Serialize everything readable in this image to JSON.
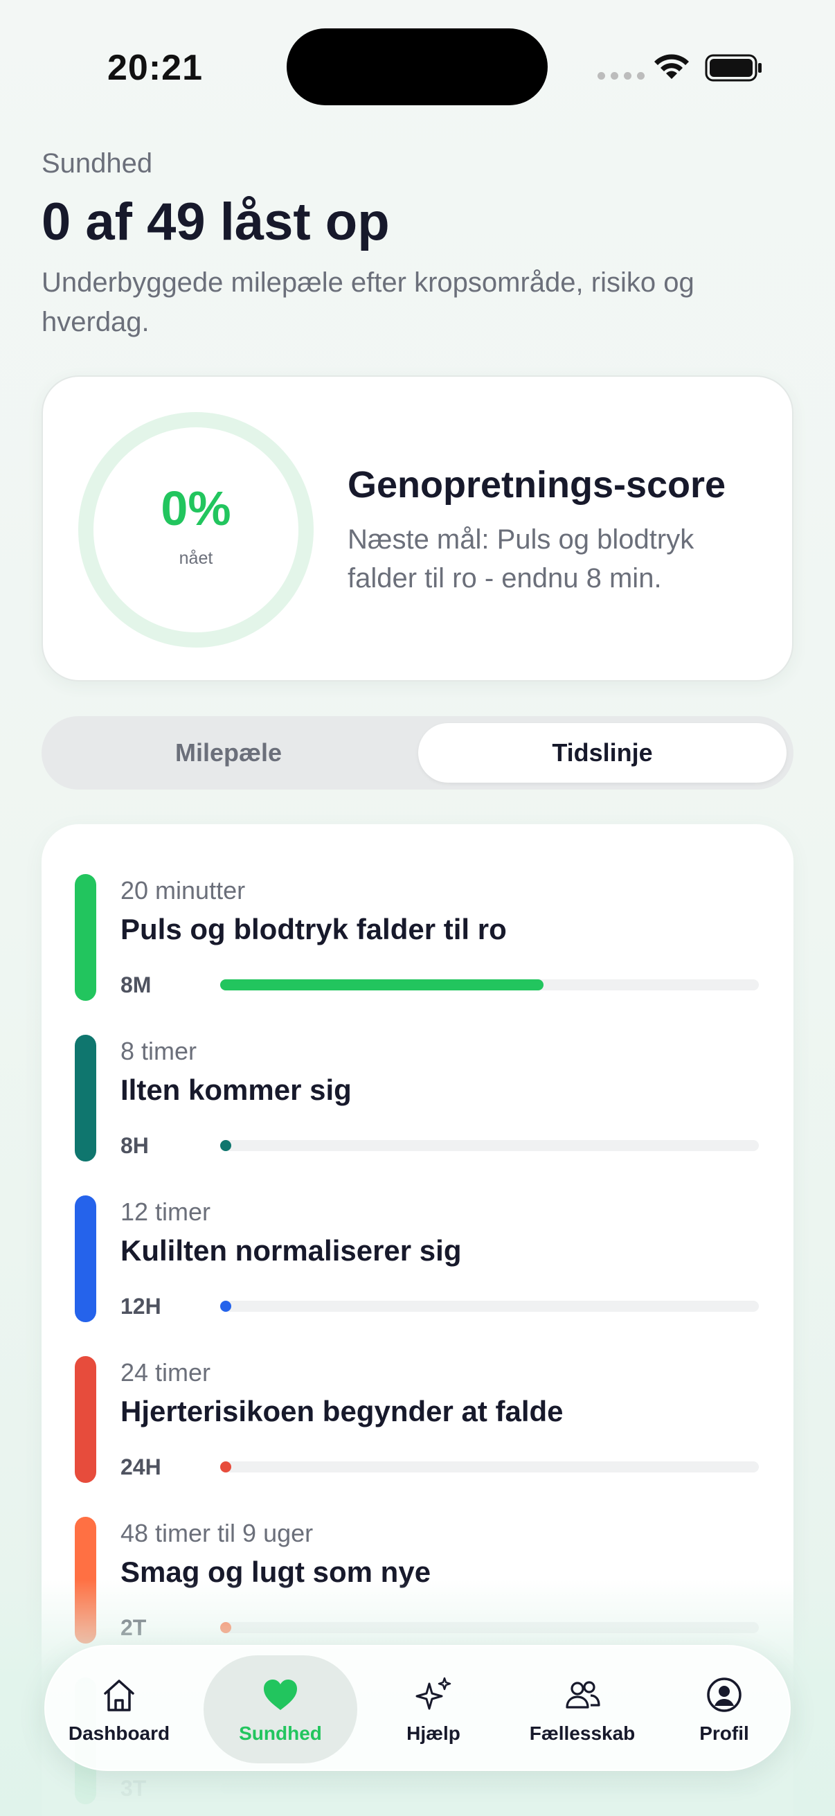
{
  "status_bar": {
    "time": "20:21"
  },
  "header": {
    "section": "Sundhed",
    "title": "0 af 49 låst op",
    "subtitle": "Underbyggede milepæle efter kropsområde, risiko og hverdag."
  },
  "score": {
    "percent": "0%",
    "percent_caption": "nået",
    "title": "Genopretnings-score",
    "next_goal": "Næste mål: Puls og blodtryk falder til ro - endnu 8 min."
  },
  "segmented": {
    "milestones_label": "Milepæle",
    "timeline_label": "Tidslinje",
    "selected": "Tidslinje"
  },
  "timeline": {
    "items": [
      {
        "duration": "20 minutter",
        "title": "Puls og blodtryk falder til ro",
        "short": "8M",
        "progress": 0.6,
        "color": "#22c55e"
      },
      {
        "duration": "8 timer",
        "title": "Ilten kommer sig",
        "short": "8H",
        "progress": 0.02,
        "color": "#0f766e"
      },
      {
        "duration": "12 timer",
        "title": "Kulilten normaliserer sig",
        "short": "12H",
        "progress": 0.01,
        "color": "#2563eb"
      },
      {
        "duration": "24 timer",
        "title": "Hjerterisikoen begynder at falde",
        "short": "24H",
        "progress": 0.005,
        "color": "#e74c3c"
      },
      {
        "duration": "48 timer til 9 uger",
        "title": "Smag og lugt som nye",
        "short": "2T",
        "progress": 0.003,
        "color": "#ff7043"
      },
      {
        "duration": "",
        "title": "",
        "short": "3T",
        "progress": 0.0,
        "color": "#22c55e"
      }
    ]
  },
  "tab_bar": {
    "tabs": [
      {
        "label": "Dashboard",
        "icon": "home-icon"
      },
      {
        "label": "Sundhed",
        "icon": "heart-icon"
      },
      {
        "label": "Hjælp",
        "icon": "sparkles-icon"
      },
      {
        "label": "Fællesskab",
        "icon": "people-icon"
      },
      {
        "label": "Profil",
        "icon": "profile-icon"
      }
    ],
    "active": "Sundhed",
    "accent": "#22c55e"
  }
}
